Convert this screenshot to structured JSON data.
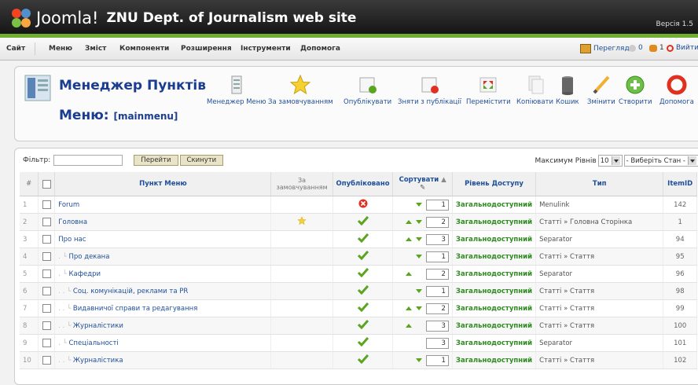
{
  "header": {
    "brand": "Joomla!",
    "site_title": "ZNU Dept. of Journalism web site",
    "version": "Версія 1.5"
  },
  "menu": [
    "Сайт",
    "Меню",
    "Зміст",
    "Компоненти",
    "Розширення",
    "Інструменти",
    "Допомога"
  ],
  "status": {
    "preview": "Перегляд",
    "messages": "0",
    "users": "1",
    "logout": "Вийти"
  },
  "toolbar": {
    "title": "Менеджер Пунктів",
    "subtitle_prefix": "Меню:",
    "subtitle_menu": "[mainmenu]",
    "buttons": [
      "Менеджер Меню",
      "За замовчуванням",
      "Опублікувати",
      "Зняти з публікації",
      "Перемістити",
      "Копіювати",
      "Кошик",
      "Змінити",
      "Створити",
      "Допомога"
    ]
  },
  "filter": {
    "label": "Фільтр:",
    "value": "",
    "go": "Перейти",
    "reset": "Скинути",
    "max_levels_label": "Максимум Рівнів",
    "max_levels_value": "10",
    "state_select": "- Виберіть Стан -"
  },
  "table": {
    "headers": {
      "num": "#",
      "item": "Пункт Меню",
      "default": "За замовчуванням",
      "published": "Опубліковано",
      "order": "Сортувати",
      "access": "Рівень Доступу",
      "type": "Тип",
      "itemid": "ItemID"
    },
    "rows": [
      {
        "num": "1",
        "prefix": "",
        "name": "Forum",
        "default": false,
        "published": false,
        "up": false,
        "down": true,
        "order": "1",
        "access": "Загальнодоступний",
        "type": "Menulink",
        "itemid": "142"
      },
      {
        "num": "2",
        "prefix": "",
        "name": "Головна",
        "default": true,
        "published": true,
        "up": true,
        "down": true,
        "order": "2",
        "access": "Загальнодоступний",
        "type": "Статті » Головна Сторінка",
        "itemid": "1"
      },
      {
        "num": "3",
        "prefix": "",
        "name": "Про нас",
        "default": false,
        "published": true,
        "up": true,
        "down": true,
        "order": "3",
        "access": "Загальнодоступний",
        "type": "Separator",
        "itemid": "94"
      },
      {
        "num": "4",
        "prefix": ". ",
        "name": "Про декана",
        "default": false,
        "published": true,
        "up": false,
        "down": true,
        "order": "1",
        "access": "Загальнодоступний",
        "type": "Статті » Стаття",
        "itemid": "95"
      },
      {
        "num": "5",
        "prefix": ". ",
        "name": "Кафедри",
        "default": false,
        "published": true,
        "up": true,
        "down": false,
        "order": "2",
        "access": "Загальнодоступний",
        "type": "Separator",
        "itemid": "96"
      },
      {
        "num": "6",
        "prefix": ". . ",
        "name": "Соц. комунікацій, реклами та PR",
        "default": false,
        "published": true,
        "up": false,
        "down": true,
        "order": "1",
        "access": "Загальнодоступний",
        "type": "Статті » Стаття",
        "itemid": "98"
      },
      {
        "num": "7",
        "prefix": ". . ",
        "name": "Видавничої справи та редагування",
        "default": false,
        "published": true,
        "up": true,
        "down": true,
        "order": "2",
        "access": "Загальнодоступний",
        "type": "Статті » Стаття",
        "itemid": "99"
      },
      {
        "num": "8",
        "prefix": ". . ",
        "name": "Журналістики",
        "default": false,
        "published": true,
        "up": true,
        "down": false,
        "order": "3",
        "access": "Загальнодоступний",
        "type": "Статті » Стаття",
        "itemid": "100"
      },
      {
        "num": "9",
        "prefix": ". ",
        "name": "Спеціальності",
        "default": false,
        "published": true,
        "up": false,
        "down": false,
        "order": "3",
        "access": "Загальнодоступний",
        "type": "Separator",
        "itemid": "101"
      },
      {
        "num": "10",
        "prefix": ". . ",
        "name": "Журналістика",
        "default": false,
        "published": true,
        "up": false,
        "down": true,
        "order": "1",
        "access": "Загальнодоступний",
        "type": "Статті » Стаття",
        "itemid": "102"
      }
    ]
  }
}
